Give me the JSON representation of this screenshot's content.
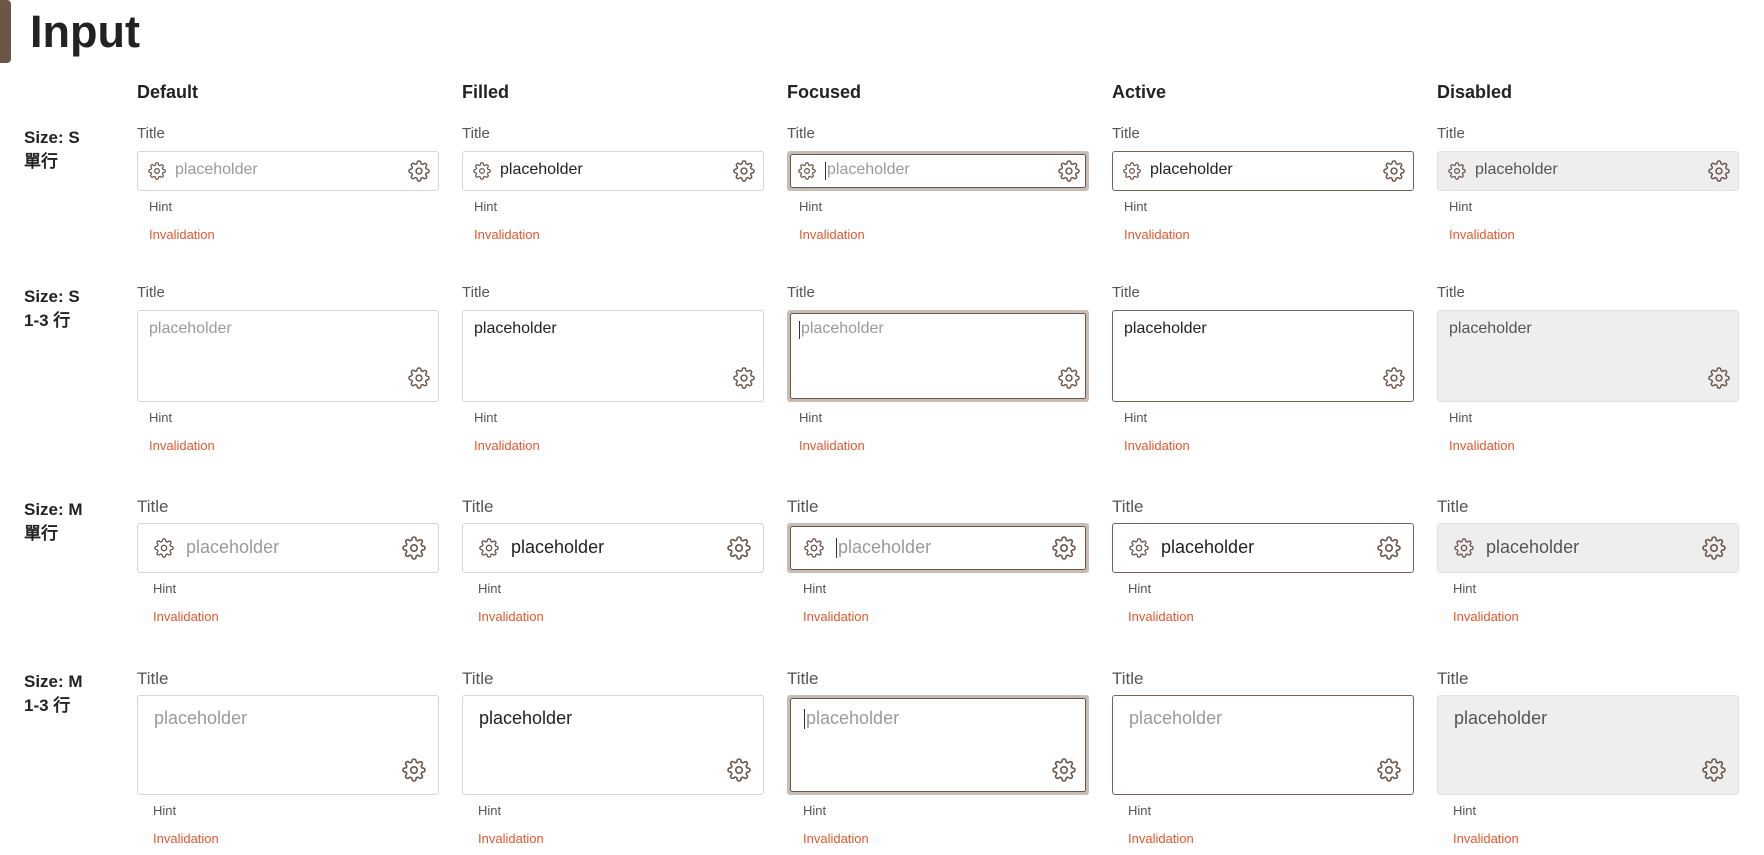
{
  "page": {
    "title": "Input"
  },
  "columns": [
    "Default",
    "Filled",
    "Focused",
    "Active",
    "Disabled"
  ],
  "rows": [
    {
      "label": "Size: S\n單行"
    },
    {
      "label": "Size: S\n1-3 行"
    },
    {
      "label": "Size: M\n單行"
    },
    {
      "label": "Size: M\n1-3 行"
    }
  ],
  "field": {
    "title": "Title",
    "placeholder": "placeholder",
    "hint": "Hint",
    "invalidation": "Invalidation"
  },
  "icons": {
    "leading": "gear-icon",
    "trailing": "gear-icon"
  },
  "colors": {
    "accent": "#6b564a",
    "focus_ring": "#c7bdb5",
    "error": "#e4572e",
    "disabled_bg": "#eeeeee"
  }
}
